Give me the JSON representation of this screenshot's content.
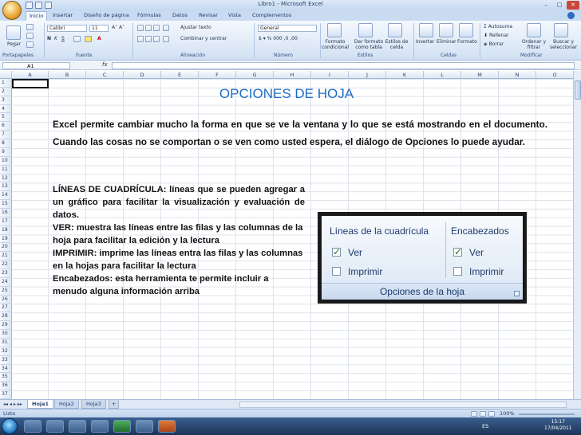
{
  "window": {
    "title": "Libro1 - Microsoft Excel"
  },
  "tabs": [
    "Inicio",
    "Insertar",
    "Diseño de página",
    "Fórmulas",
    "Datos",
    "Revisar",
    "Vista",
    "Complementos"
  ],
  "ribbon": {
    "paste_label": "Pegar",
    "font_name": "Calibri",
    "font_size": "11",
    "wrap_text": "Ajustar texto",
    "merge_center": "Combinar y centrar",
    "number_format": "General",
    "conditional_format": "Formato condicional",
    "table_format": "Dar formato como tabla",
    "cell_styles": "Estilos de celda",
    "insert": "Insertar",
    "delete": "Eliminar",
    "format": "Formato",
    "autosum": "Autosuma",
    "fill": "Rellenar",
    "clear": "Borrar",
    "sort_filter": "Ordenar y filtrar",
    "find_select": "Buscar y seleccionar",
    "groups": {
      "clipboard": "Portapapeles",
      "font": "Fuente",
      "alignment": "Alineación",
      "number": "Número",
      "styles": "Estilos",
      "cells": "Celdas",
      "editing": "Modificar"
    }
  },
  "formula_bar": {
    "name_box": "A1",
    "fx": "fx"
  },
  "grid": {
    "columns": [
      "A",
      "B",
      "C",
      "D",
      "E",
      "F",
      "G",
      "H",
      "I",
      "J",
      "K",
      "L",
      "M",
      "N",
      "O"
    ],
    "rows": [
      "1",
      "2",
      "3",
      "4",
      "5",
      "6",
      "7",
      "8",
      "9",
      "10",
      "11",
      "12",
      "13",
      "14",
      "15",
      "16",
      "17",
      "18",
      "19",
      "20",
      "21",
      "22",
      "23",
      "24",
      "25",
      "26",
      "27",
      "28",
      "29",
      "30",
      "31",
      "32",
      "33",
      "34",
      "35",
      "36",
      "37"
    ]
  },
  "sheets": [
    "Hoja1",
    "Hoja2",
    "Hoja3"
  ],
  "status": {
    "text": "Listo",
    "zoom": "100%"
  },
  "taskbar": {
    "lang": "ES",
    "time": "15:17",
    "date": "17/04/2011"
  },
  "slide": {
    "title": "OPCIONES DE HOJA",
    "intro": "Excel permite cambiar mucho la forma en que se ve la ventana y lo que se está mostrando en el documento. Cuando las cosas no se comportan o se ven como usted espera, el diálogo de Opciones lo puede ayudar.",
    "gridlines_desc": "LÍNEAS DE CUADRÍCULA: líneas que se pueden agregar a un gráfico para facilitar la visualización y evaluación de datos.",
    "view_desc": "VER: muestra las líneas entre las filas y las columnas de la hoja para facilitar la edición y la lectura",
    "print_desc": "IMPRIMIR: imprime las líneas entra las filas y las columnas en la hojas para facilitar la lectura",
    "headers_desc": "Encabezados: esta herramienta te permite incluir a menudo alguna información arriba"
  },
  "options_panel": {
    "gridlines_title": "Líneas de la cuadrícula",
    "headers_title": "Encabezados",
    "view": "Ver",
    "print": "Imprimir",
    "footer": "Opciones de la hoja",
    "gridlines_view_checked": true,
    "gridlines_print_checked": false,
    "headers_view_checked": true,
    "headers_print_checked": false
  }
}
